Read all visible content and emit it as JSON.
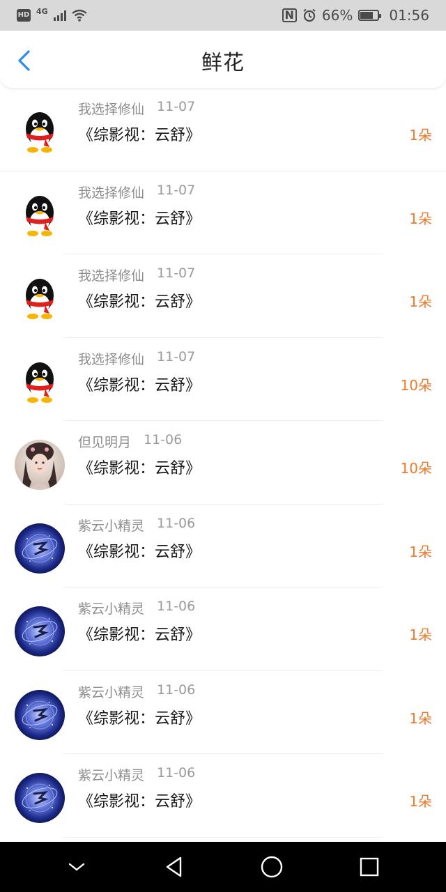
{
  "status_bar": {
    "left": {
      "hd": "HD",
      "network": "4G"
    },
    "battery_percent": "66%",
    "time": "01:56"
  },
  "header": {
    "title": "鲜花"
  },
  "items": [
    {
      "user": "我选择修仙",
      "date": "11-07",
      "book": "《综影视：云舒》",
      "count": "1朵",
      "avatar": "qq-penguin"
    },
    {
      "user": "我选择修仙",
      "date": "11-07",
      "book": "《综影视：云舒》",
      "count": "1朵",
      "avatar": "qq-penguin"
    },
    {
      "user": "我选择修仙",
      "date": "11-07",
      "book": "《综影视：云舒》",
      "count": "1朵",
      "avatar": "qq-penguin"
    },
    {
      "user": "我选择修仙",
      "date": "11-07",
      "book": "《综影视：云舒》",
      "count": "10朵",
      "avatar": "qq-penguin"
    },
    {
      "user": "但见明月",
      "date": "11-06",
      "book": "《综影视：云舒》",
      "count": "10朵",
      "avatar": "portrait-photo"
    },
    {
      "user": "紫云小精灵",
      "date": "11-06",
      "book": "《综影视：云舒》",
      "count": "1朵",
      "avatar": "nebula"
    },
    {
      "user": "紫云小精灵",
      "date": "11-06",
      "book": "《综影视：云舒》",
      "count": "1朵",
      "avatar": "nebula"
    },
    {
      "user": "紫云小精灵",
      "date": "11-06",
      "book": "《综影视：云舒》",
      "count": "1朵",
      "avatar": "nebula"
    },
    {
      "user": "紫云小精灵",
      "date": "11-06",
      "book": "《综影视：云舒》",
      "count": "1朵",
      "avatar": "nebula"
    }
  ],
  "colors": {
    "accent_back": "#2a8cf0",
    "count": "#f07a2a"
  }
}
